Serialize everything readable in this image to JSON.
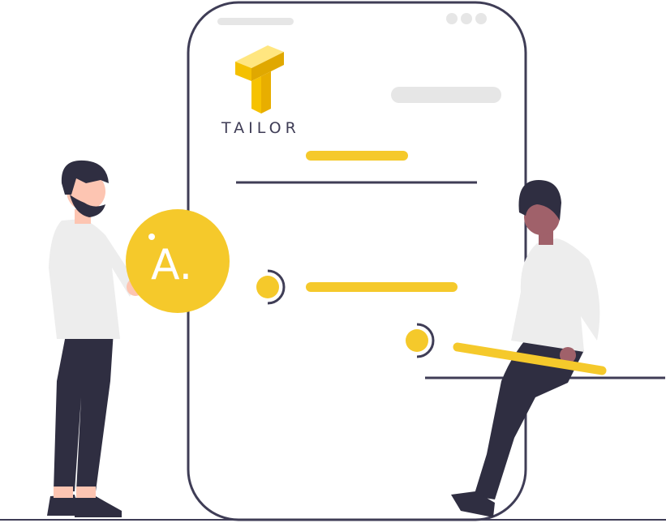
{
  "brand": {
    "name": "TAILOR",
    "logo_icon": "tailor-t-logo-icon",
    "text_color": "#3f3d56"
  },
  "coin": {
    "letter": "A.",
    "icon": "letter-a-coin-icon"
  },
  "colors": {
    "accent": "#f5c92b",
    "accent_dark": "#e8b400",
    "outline": "#3f3d56",
    "placeholder": "#e6e6e6",
    "clothing_light": "#ededed",
    "clothing_dark": "#2f2e41",
    "skin_light": "#fdc5b2",
    "skin_dark": "#a0616a"
  }
}
